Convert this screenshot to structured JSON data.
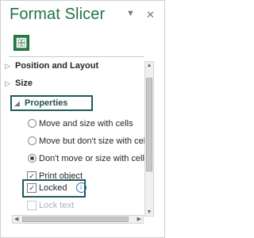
{
  "pane": {
    "title": "Format Slicer",
    "options_icon": "chevron-down-icon",
    "close_glyph": "✕"
  },
  "toolbar": {
    "icon": "size-properties-icon"
  },
  "sections": {
    "position_layout": "Position and Layout",
    "size": "Size",
    "properties": "Properties"
  },
  "properties": {
    "radio_options": [
      "Move and size with cells",
      "Move but don't size with cells",
      "Don't move or size with cells"
    ],
    "selected_radio_index": 2,
    "print_object": "Print object",
    "print_object_checked": true,
    "locked": "Locked",
    "locked_checked": true,
    "locked_info_icon": "info-icon",
    "lock_text": "Lock text",
    "lock_text_checked": false
  },
  "colors": {
    "title": "#217346",
    "highlight_border": "#1f5a58",
    "info": "#2e74b5"
  }
}
